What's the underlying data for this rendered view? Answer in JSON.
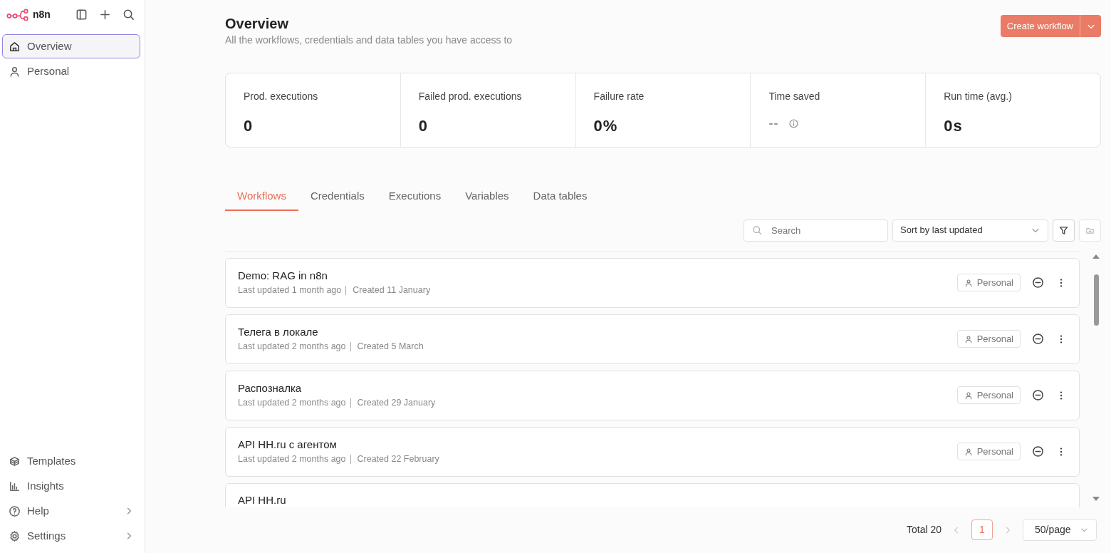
{
  "sidebar": {
    "brand": "n8n",
    "items": [
      {
        "label": "Overview",
        "selected": true
      },
      {
        "label": "Personal",
        "selected": false
      }
    ],
    "bottom_items": [
      {
        "label": "Templates",
        "submenu": false
      },
      {
        "label": "Insights",
        "submenu": false
      },
      {
        "label": "Help",
        "submenu": true
      },
      {
        "label": "Settings",
        "submenu": true
      }
    ]
  },
  "header": {
    "title": "Overview",
    "subtitle": "All the workflows, credentials and data tables you have access to",
    "create_button": "Create workflow"
  },
  "stats": [
    {
      "label": "Prod. executions",
      "value": "0",
      "muted": false,
      "info": false
    },
    {
      "label": "Failed prod. executions",
      "value": "0",
      "muted": false,
      "info": false
    },
    {
      "label": "Failure rate",
      "value": "0%",
      "muted": false,
      "info": false
    },
    {
      "label": "Time saved",
      "value": "--",
      "muted": true,
      "info": true
    },
    {
      "label": "Run time (avg.)",
      "value": "0s",
      "muted": false,
      "info": false
    }
  ],
  "tabs": [
    {
      "label": "Workflows",
      "selected": true
    },
    {
      "label": "Credentials",
      "selected": false
    },
    {
      "label": "Executions",
      "selected": false
    },
    {
      "label": "Variables",
      "selected": false
    },
    {
      "label": "Data tables",
      "selected": false
    }
  ],
  "toolbar": {
    "search_placeholder": "Search",
    "sort": "Sort by last updated"
  },
  "workflows": [
    {
      "title": "Demo: RAG in n8n",
      "updated": "Last updated 1 month ago",
      "created": "Created 11 January",
      "owner": "Personal"
    },
    {
      "title": "Телега в локале",
      "updated": "Last updated 2 months ago",
      "created": "Created 5 March",
      "owner": "Personal"
    },
    {
      "title": "Распозналка",
      "updated": "Last updated 2 months ago",
      "created": "Created 29 January",
      "owner": "Personal"
    },
    {
      "title": "API HH.ru с агентом",
      "updated": "Last updated 2 months ago",
      "created": "Created 22 February",
      "owner": "Personal"
    },
    {
      "title": "API HH.ru"
    }
  ],
  "pagination": {
    "total": "Total 20",
    "pages": [
      {
        "label": "1",
        "selected": true
      }
    ],
    "page_size": "50/page"
  }
}
